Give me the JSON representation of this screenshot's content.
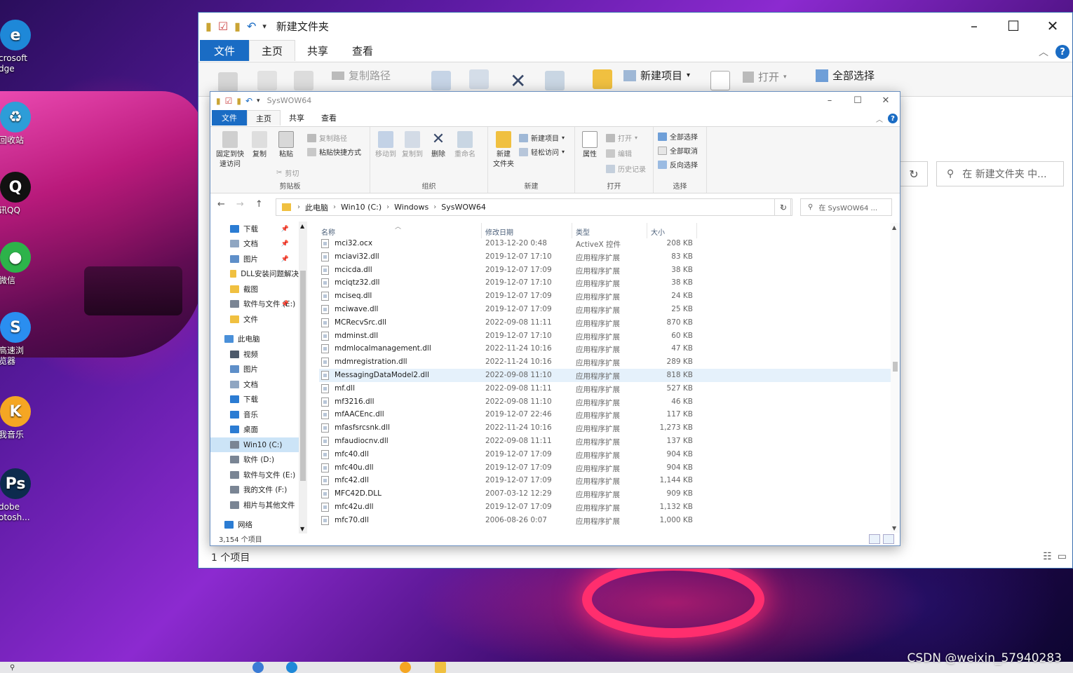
{
  "desktop": {
    "icons": [
      {
        "name": "edge-icon",
        "label": "crosoft\ndge",
        "color": "#1e88d8",
        "glyph": "e"
      },
      {
        "name": "recycle-bin-icon",
        "label": "回收站",
        "color": "#2d9dd8",
        "glyph": "♻"
      },
      {
        "name": "qq-icon",
        "label": "讯QQ",
        "color": "#111111",
        "glyph": "Q"
      },
      {
        "name": "wechat-icon",
        "label": "微信",
        "color": "#2db34a",
        "glyph": "●"
      },
      {
        "name": "browser-icon",
        "label": "高速浏\n览器",
        "color": "#2a8ef0",
        "glyph": "S"
      },
      {
        "name": "music-icon",
        "label": "我音乐",
        "color": "#f5a623",
        "glyph": "K"
      },
      {
        "name": "photoshop-icon",
        "label": "dobe\notosh...",
        "color": "#0d2b4e",
        "glyph": "Ps"
      }
    ],
    "watermark": "CSDN @weixin_57940283"
  },
  "outer_window": {
    "title": "新建文件夹",
    "tabs": [
      "文件",
      "主页",
      "共享",
      "查看"
    ],
    "ribbon": {
      "copy_path": "复制路径",
      "new_item": "新建项目",
      "open": "打开",
      "select_all": "全部选择"
    },
    "search_placeholder": "在 新建文件夹 中...",
    "status": "1 个项目"
  },
  "inner_window": {
    "title": "SysWOW64",
    "tabs": [
      "文件",
      "主页",
      "共享",
      "查看"
    ],
    "ribbon": {
      "groups": [
        "剪贴板",
        "组织",
        "新建",
        "打开",
        "选择"
      ],
      "pin": "固定到快\n速访问",
      "copy": "复制",
      "paste": "粘贴",
      "copy_path": "复制路径",
      "paste_shortcut": "粘贴快捷方式",
      "cut": "剪切",
      "move_to": "移动到",
      "copy_to": "复制到",
      "delete": "删除",
      "rename": "重命名",
      "new_folder": "新建\n文件夹",
      "new_item": "新建项目",
      "easy_access": "轻松访问",
      "properties": "属性",
      "open": "打开",
      "edit": "编辑",
      "history": "历史记录",
      "select_all": "全部选择",
      "select_none": "全部取消",
      "invert": "反向选择"
    },
    "breadcrumb": [
      "此电脑",
      "Win10 (C:)",
      "Windows",
      "SysWOW64"
    ],
    "search_placeholder": "在 SysWOW64 ...",
    "nav": [
      {
        "label": "下载",
        "pinned": true,
        "icon": "download-icon",
        "indent": 1
      },
      {
        "label": "文档",
        "pinned": true,
        "icon": "document-icon",
        "indent": 1
      },
      {
        "label": "图片",
        "pinned": true,
        "icon": "picture-icon",
        "indent": 1
      },
      {
        "label": "DLL安装问题解决",
        "pinned": false,
        "icon": "folder-icon",
        "indent": 1
      },
      {
        "label": "截图",
        "pinned": false,
        "icon": "folder-icon",
        "indent": 1
      },
      {
        "label": "软件与文件 (E:)",
        "pinned": true,
        "icon": "drive-icon",
        "indent": 1
      },
      {
        "label": "文件",
        "pinned": false,
        "icon": "folder-icon",
        "indent": 1
      },
      {
        "label": "此电脑",
        "pinned": false,
        "icon": "computer-icon",
        "indent": 0
      },
      {
        "label": "视频",
        "pinned": false,
        "icon": "video-icon",
        "indent": 1
      },
      {
        "label": "图片",
        "pinned": false,
        "icon": "picture-icon",
        "indent": 1
      },
      {
        "label": "文档",
        "pinned": false,
        "icon": "document-icon",
        "indent": 1
      },
      {
        "label": "下载",
        "pinned": false,
        "icon": "download-icon",
        "indent": 1
      },
      {
        "label": "音乐",
        "pinned": false,
        "icon": "music-note-icon",
        "indent": 1
      },
      {
        "label": "桌面",
        "pinned": false,
        "icon": "desktop-icon",
        "indent": 1
      },
      {
        "label": "Win10 (C:)",
        "pinned": false,
        "icon": "drive-icon",
        "indent": 1,
        "selected": true
      },
      {
        "label": "软件 (D:)",
        "pinned": false,
        "icon": "drive-icon",
        "indent": 1
      },
      {
        "label": "软件与文件 (E:)",
        "pinned": false,
        "icon": "drive-icon",
        "indent": 1
      },
      {
        "label": "我的文件 (F:)",
        "pinned": false,
        "icon": "drive-icon",
        "indent": 1
      },
      {
        "label": "相片与其他文件",
        "pinned": false,
        "icon": "drive-icon",
        "indent": 1
      },
      {
        "label": "网络",
        "pinned": false,
        "icon": "network-icon",
        "indent": 0
      }
    ],
    "columns": [
      "名称",
      "修改日期",
      "类型",
      "大小"
    ],
    "files": [
      [
        "mci32.ocx",
        "2013-12-20 0:48",
        "ActiveX 控件",
        "208 KB"
      ],
      [
        "mciavi32.dll",
        "2019-12-07 17:10",
        "应用程序扩展",
        "83 KB"
      ],
      [
        "mcicda.dll",
        "2019-12-07 17:09",
        "应用程序扩展",
        "38 KB"
      ],
      [
        "mciqtz32.dll",
        "2019-12-07 17:10",
        "应用程序扩展",
        "38 KB"
      ],
      [
        "mciseq.dll",
        "2019-12-07 17:09",
        "应用程序扩展",
        "24 KB"
      ],
      [
        "mciwave.dll",
        "2019-12-07 17:09",
        "应用程序扩展",
        "25 KB"
      ],
      [
        "MCRecvSrc.dll",
        "2022-09-08 11:11",
        "应用程序扩展",
        "870 KB"
      ],
      [
        "mdminst.dll",
        "2019-12-07 17:10",
        "应用程序扩展",
        "60 KB"
      ],
      [
        "mdmlocalmanagement.dll",
        "2022-11-24 10:16",
        "应用程序扩展",
        "47 KB"
      ],
      [
        "mdmregistration.dll",
        "2022-11-24 10:16",
        "应用程序扩展",
        "289 KB"
      ],
      [
        "MessagingDataModel2.dll",
        "2022-09-08 11:10",
        "应用程序扩展",
        "818 KB"
      ],
      [
        "mf.dll",
        "2022-09-08 11:11",
        "应用程序扩展",
        "527 KB"
      ],
      [
        "mf3216.dll",
        "2022-09-08 11:10",
        "应用程序扩展",
        "46 KB"
      ],
      [
        "mfAACEnc.dll",
        "2019-12-07 22:46",
        "应用程序扩展",
        "117 KB"
      ],
      [
        "mfasfsrcsnk.dll",
        "2022-11-24 10:16",
        "应用程序扩展",
        "1,273 KB"
      ],
      [
        "mfaudiocnv.dll",
        "2022-09-08 11:11",
        "应用程序扩展",
        "137 KB"
      ],
      [
        "mfc40.dll",
        "2019-12-07 17:09",
        "应用程序扩展",
        "904 KB"
      ],
      [
        "mfc40u.dll",
        "2019-12-07 17:09",
        "应用程序扩展",
        "904 KB"
      ],
      [
        "mfc42.dll",
        "2019-12-07 17:09",
        "应用程序扩展",
        "1,144 KB"
      ],
      [
        "MFC42D.DLL",
        "2007-03-12 12:29",
        "应用程序扩展",
        "909 KB"
      ],
      [
        "mfc42u.dll",
        "2019-12-07 17:09",
        "应用程序扩展",
        "1,132 KB"
      ],
      [
        "mfc70.dll",
        "2006-08-26 0:07",
        "应用程序扩展",
        "1,000 KB"
      ]
    ],
    "selected_file": "MessagingDataModel2.dll",
    "status": "3,154 个项目"
  }
}
